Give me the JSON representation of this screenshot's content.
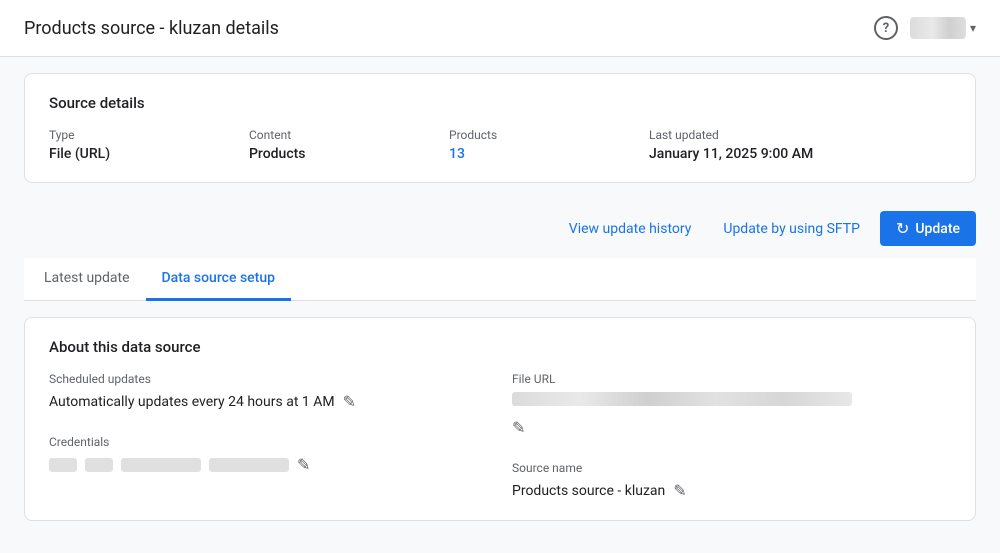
{
  "header": {
    "title": "Products source - kluzan details",
    "help_aria": "Help",
    "account_dropdown_aria": "Account dropdown"
  },
  "source_details": {
    "section_title": "Source details",
    "type_label": "Type",
    "type_value": "File (URL)",
    "content_label": "Content",
    "content_value": "Products",
    "products_label": "Products",
    "products_value": "13",
    "last_updated_label": "Last updated",
    "last_updated_value": "January 11, 2025 9:00 AM"
  },
  "actions": {
    "view_history_label": "View update history",
    "sftp_label": "Update by using SFTP",
    "update_label": "Update"
  },
  "tabs": [
    {
      "id": "latest-update",
      "label": "Latest update",
      "active": false
    },
    {
      "id": "data-source-setup",
      "label": "Data source setup",
      "active": true
    }
  ],
  "about_section": {
    "title": "About this data source",
    "scheduled_updates_label": "Scheduled updates",
    "scheduled_updates_value": "Automatically updates every 24 hours at 1 AM",
    "file_url_label": "File URL",
    "credentials_label": "Credentials",
    "source_name_label": "Source name",
    "source_name_value": "Products source - kluzan"
  },
  "icons": {
    "help": "?",
    "chevron_down": "▾",
    "refresh": "↻",
    "edit": "✎"
  }
}
